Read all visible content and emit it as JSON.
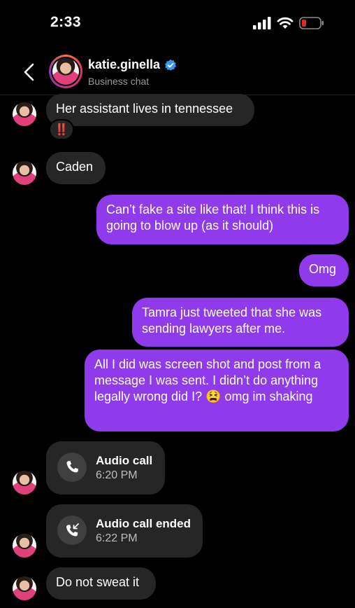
{
  "status_bar": {
    "time": "2:33"
  },
  "header": {
    "name": "katie.ginella",
    "subtitle": "Business chat"
  },
  "messages": [
    {
      "direction": "incoming",
      "text": "Her assistant lives in tennessee",
      "reaction": "‼️"
    },
    {
      "direction": "incoming",
      "text": "Caden"
    },
    {
      "direction": "outgoing",
      "text": "Can’t fake a site like that! I think this is going to blow up (as it should)"
    },
    {
      "direction": "outgoing",
      "text": "Omg"
    },
    {
      "direction": "outgoing",
      "text": "Tamra just tweeted that she was sending lawyers after me."
    },
    {
      "direction": "outgoing",
      "text": "All I did was screen shot and post from a message I was sent. I didn’t do anything legally wrong did I? 😫 omg im shaking"
    },
    {
      "direction": "incoming",
      "type": "call",
      "title": "Audio call",
      "time": "6:20 PM",
      "icon": "phone-icon"
    },
    {
      "direction": "incoming",
      "type": "call",
      "title": "Audio call ended",
      "time": "6:22 PM",
      "icon": "missed-call-icon"
    },
    {
      "direction": "incoming",
      "text": "Do not sweat it"
    }
  ],
  "colors": {
    "outgoing": "#8f3bec",
    "incoming": "#262626",
    "verified": "#3897f0",
    "battery_low": "#e02a2a"
  }
}
